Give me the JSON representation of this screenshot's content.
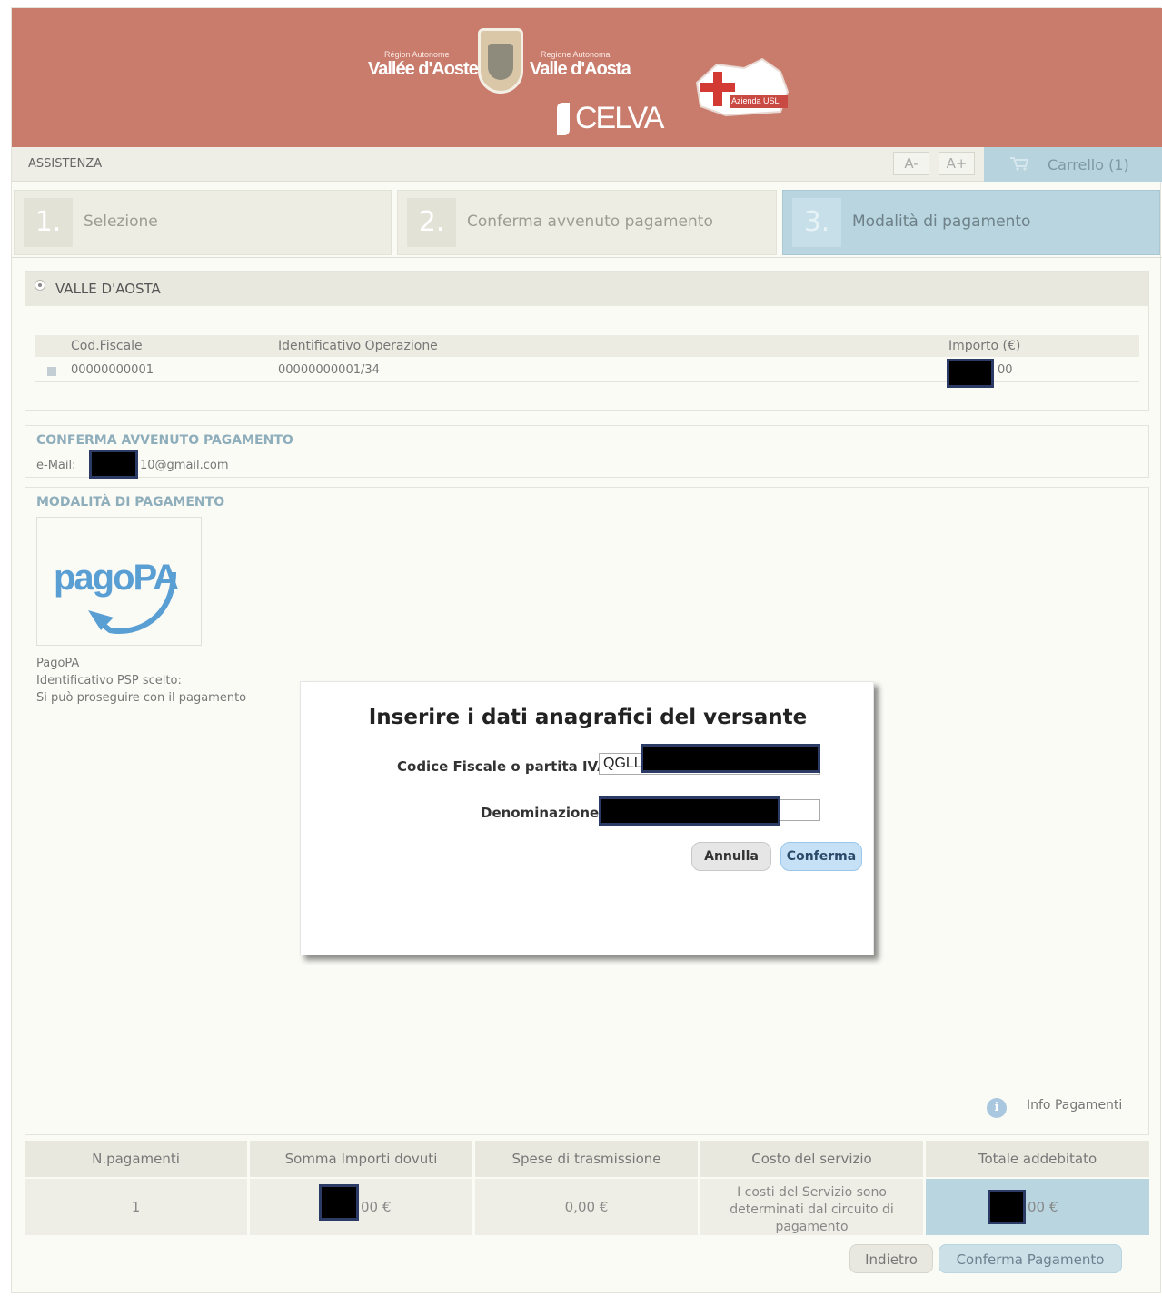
{
  "header": {
    "logo_left_small": "Région Autonome",
    "logo_left": "Vallée d'Aoste",
    "logo_right_small": "Regione Autonoma",
    "logo_right": "Valle d'Aosta",
    "celva": "CELVA",
    "usl_label": "Azienda USL"
  },
  "toolbar": {
    "assistenza": "ASSISTENZA",
    "font_decrease": "A-",
    "font_increase": "A+",
    "cart_label": "Carrello (1)"
  },
  "steps": [
    {
      "num": "1.",
      "label": "Selezione"
    },
    {
      "num": "2.",
      "label": "Conferma avvenuto pagamento"
    },
    {
      "num": "3.",
      "label": "Modalità di pagamento"
    }
  ],
  "region": {
    "title": "VALLE D'AOSTA",
    "columns": [
      "Cod.Fiscale",
      "Identificativo Operazione",
      "Importo (€)"
    ],
    "rows": [
      {
        "cod_fiscale": "00000000001",
        "id_operazione": "00000000001/34",
        "importo_suffix": "00"
      }
    ]
  },
  "conferma": {
    "title": "CONFERMA AVVENUTO PAGAMENTO",
    "email_label": "e-Mail:",
    "email_suffix": "10@gmail.com"
  },
  "modalita": {
    "title": "MODALITÀ DI PAGAMENTO",
    "logo_text": "pagoPA",
    "line1": "PagoPA",
    "line2": "Identificativo PSP scelto:",
    "line3": "Si può proseguire con il pagamento",
    "info_link": "Info Pagamenti"
  },
  "summary": {
    "headers": [
      "N.pagamenti",
      "Somma Importi dovuti",
      "Spese di trasmissione",
      "Costo del servizio",
      "Totale addebitato"
    ],
    "n_pagamenti": "1",
    "somma_suffix": "00 €",
    "spese": "0,00 €",
    "costo": "I costi del Servizio sono determinati dal circuito di pagamento",
    "totale_suffix": "00 €"
  },
  "buttons": {
    "indietro": "Indietro",
    "conferma_pagamento": "Conferma Pagamento"
  },
  "modal": {
    "title": "Inserire i dati anagrafici del versante",
    "cf_label": "Codice Fiscale o partita IVA",
    "cf_value": "QGLL",
    "den_label": "Denominazione",
    "den_value": "",
    "annulla": "Annulla",
    "conferma": "Conferma"
  },
  "colors": {
    "header_bg": "#c97b6c",
    "active_step": "#b8d5e0",
    "section_title": "#8faebb"
  }
}
